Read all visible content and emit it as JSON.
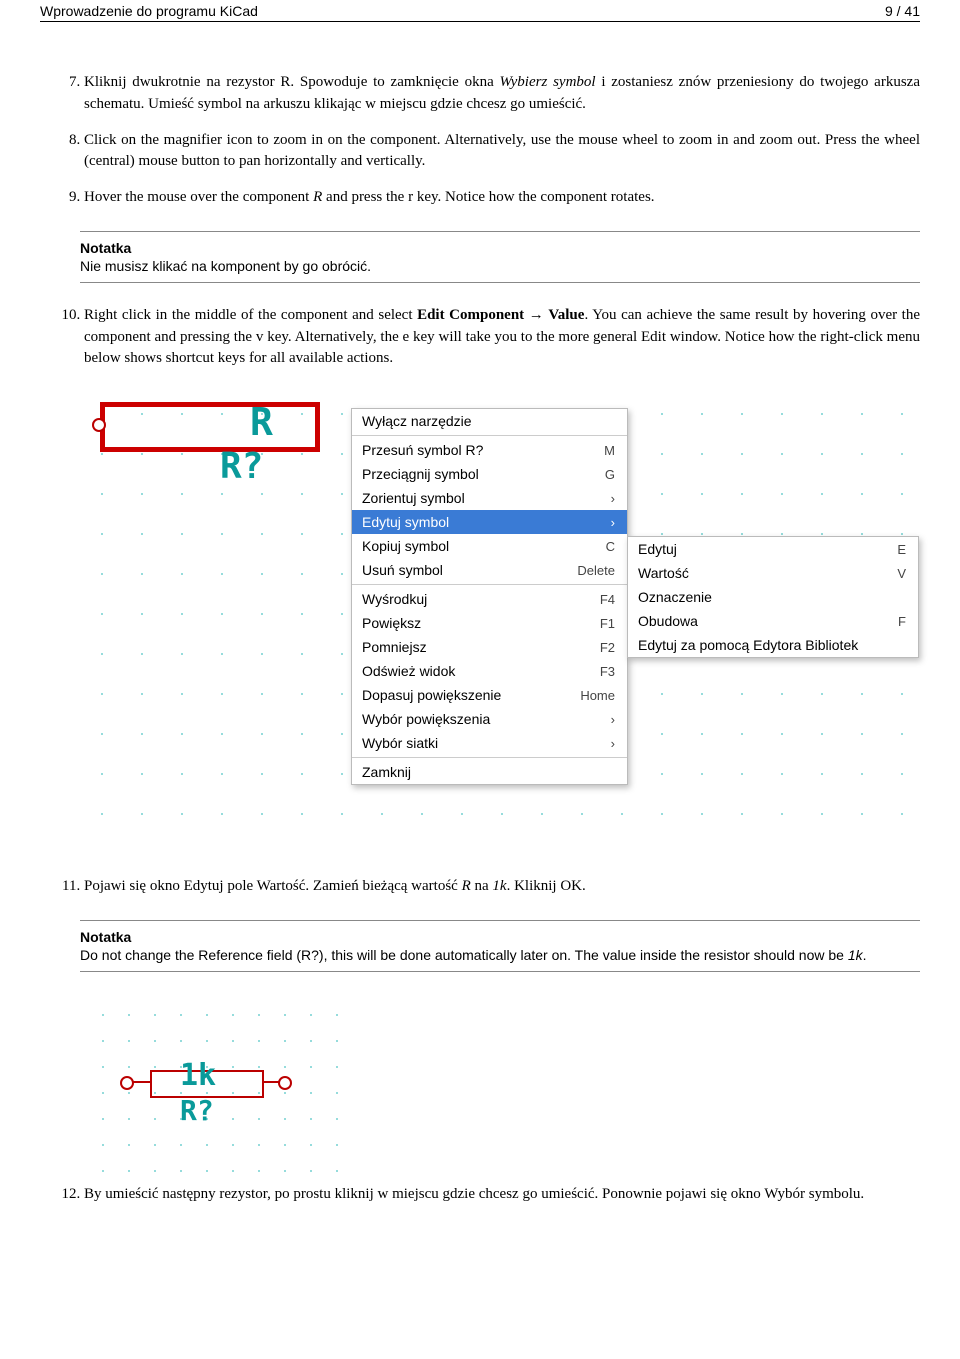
{
  "header": {
    "title": "Wprowadzenie do programu KiCad",
    "page": "9 / 41"
  },
  "items": {
    "i7": {
      "pre": "Kliknij dwukrotnie na rezystor R. Spowoduje to zamknięcie okna ",
      "em1": "Wybierz symbol",
      "mid": " i zostaniesz znów przeniesiony do twojego arkusza schematu. Umieść symbol na arkuszu klikając w miejscu gdzie chcesz go umieścić."
    },
    "i8": "Click on the magnifier icon to zoom in on the component. Alternatively, use the mouse wheel to zoom in and zoom out. Press the wheel (central) mouse button to pan horizontally and vertically.",
    "i9": {
      "pre": "Hover the mouse over the component ",
      "em1": "R",
      "post": " and press the r key. Notice how the component rotates."
    },
    "i10": {
      "t1": "Right click in the middle of the component and select ",
      "b1": "Edit Component",
      "arrow": " → ",
      "b2": "Value",
      "t2": ". You can achieve the same result by hovering over the component and pressing the v key. Alternatively, the e key will take you to the more general Edit window. Notice how the right-click menu below shows shortcut keys for all available actions."
    },
    "i11": {
      "t1": "Pojawi się okno Edytuj pole Wartość. Zamień bieżącą wartość ",
      "em1": "R",
      "t2": " na ",
      "em2": "1k",
      "t3": ". Kliknij OK."
    },
    "i12": "By umieścić następny rezystor, po prostu kliknij w miejscu gdzie chcesz go umieścić. Ponownie pojawi się okno Wybór symbolu."
  },
  "note1": {
    "title": "Notatka",
    "body": "Nie musisz klikać na komponent by go obrócić."
  },
  "note2": {
    "title": "Notatka",
    "body_a": "Do not change the Reference field (R?), this will be done automatically later on. The value inside the resistor should now be ",
    "body_em": "1k",
    "body_b": "."
  },
  "fig1": {
    "label_r": "R",
    "label_rq": "R?",
    "menu": [
      {
        "label": "Wyłącz narzędzie",
        "sc": ""
      },
      {
        "sep": true
      },
      {
        "label": "Przesuń symbol R?",
        "sc": "M"
      },
      {
        "label": "Przeciągnij symbol",
        "sc": "G"
      },
      {
        "label": "Zorientuj symbol",
        "sc": "›"
      },
      {
        "label": "Edytuj symbol",
        "sc": "›",
        "sel": true
      },
      {
        "label": "Kopiuj symbol",
        "sc": "C"
      },
      {
        "label": "Usuń symbol",
        "sc": "Delete"
      },
      {
        "sep": true
      },
      {
        "label": "Wyśrodkuj",
        "sc": "F4"
      },
      {
        "label": "Powiększ",
        "sc": "F1"
      },
      {
        "label": "Pomniejsz",
        "sc": "F2"
      },
      {
        "label": "Odśwież widok",
        "sc": "F3"
      },
      {
        "label": "Dopasuj powiększenie",
        "sc": "Home"
      },
      {
        "label": "Wybór powiększenia",
        "sc": "›"
      },
      {
        "label": "Wybór siatki",
        "sc": "›"
      },
      {
        "sep": true
      },
      {
        "label": "Zamknij",
        "sc": ""
      }
    ],
    "submenu": [
      {
        "label": "Edytuj",
        "sc": "E"
      },
      {
        "label": "Wartość",
        "sc": "V"
      },
      {
        "label": "Oznaczenie",
        "sc": ""
      },
      {
        "label": "Obudowa",
        "sc": "F"
      },
      {
        "label": "Edytuj za pomocą Edytora Bibliotek",
        "sc": ""
      }
    ]
  },
  "fig2": {
    "val": "1k",
    "ref": "R?"
  }
}
